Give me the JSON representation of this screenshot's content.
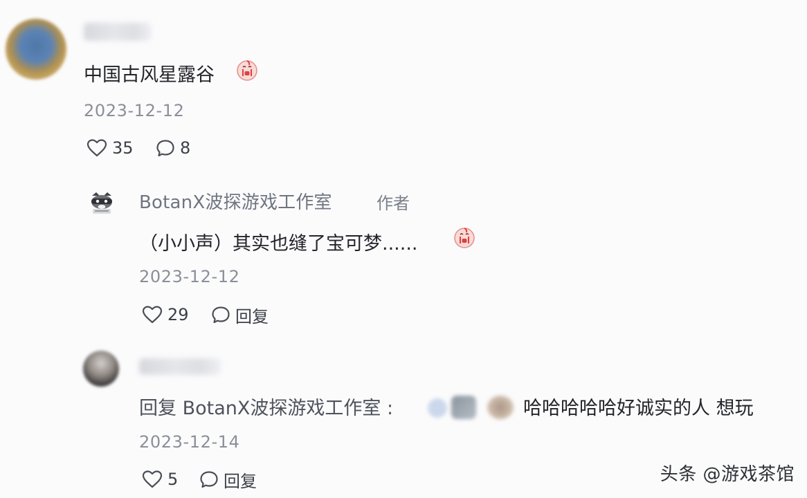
{
  "comments": [
    {
      "text": "中国古风星露谷",
      "date": "2023-12-12",
      "likes": "35",
      "replies": "8"
    }
  ],
  "author_reply": {
    "name": "BotanX波探游戏工作室",
    "badge": "作者",
    "text": "（小小声）其实也缝了宝可梦......",
    "date": "2023-12-12",
    "likes": "29",
    "reply_label": "回复"
  },
  "nested_reply": {
    "prefix": "回复 BotanX波探游戏工作室 :",
    "text": "哈哈哈哈哈好诚实的人 想玩",
    "date": "2023-12-14",
    "likes": "5",
    "reply_label": "回复"
  },
  "watermark": "头条 @游戏茶馆",
  "icons": {
    "like": "heart-outline-icon",
    "comment": "chat-bubble-icon",
    "emoji": "crying-face-icon"
  },
  "colors": {
    "background": "#fbfbfc",
    "text": "#23242a",
    "muted": "#8b8f98"
  }
}
